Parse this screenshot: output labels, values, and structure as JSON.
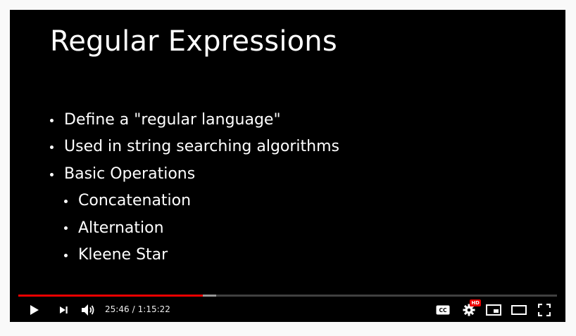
{
  "slide": {
    "title": "Regular Expressions",
    "bullets": [
      {
        "text": "Define a \"regular language\"",
        "level": 1
      },
      {
        "text": "Used in string searching algorithms",
        "level": 1
      },
      {
        "text": "Basic Operations",
        "level": 1
      },
      {
        "text": "Concatenation",
        "level": 2
      },
      {
        "text": "Alternation",
        "level": 2
      },
      {
        "text": "Kleene Star",
        "level": 2
      }
    ]
  },
  "player": {
    "current_time": "25:46",
    "separator": "/",
    "duration": "1:15:22",
    "played_fraction": 0.342,
    "buffered_fraction": 0.367,
    "quality_badge": "HD",
    "colors": {
      "progress_played": "#ee0000",
      "background": "#000000"
    },
    "icons": [
      "play-icon",
      "next-icon",
      "volume-icon",
      "subtitles-icon",
      "settings-icon",
      "miniplayer-icon",
      "theater-icon",
      "fullscreen-icon"
    ]
  }
}
